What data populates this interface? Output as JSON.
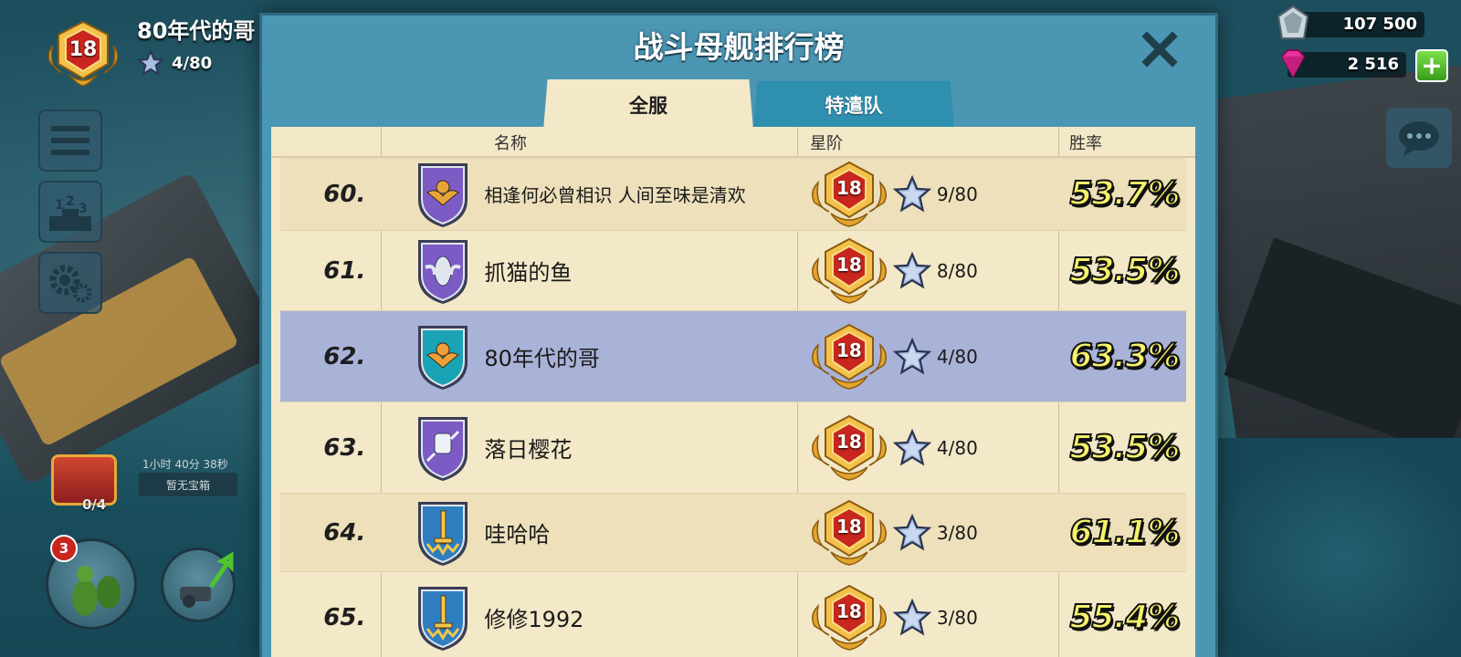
{
  "player": {
    "level": "18",
    "name": "80年代的哥",
    "stars": "4/80"
  },
  "resources": {
    "partial_left": "3",
    "steel_value": "107 500",
    "gems_value": "2 516",
    "steel_icon": "steel-icon",
    "gem_icon": "gem-icon",
    "plus_icon": "plus-icon"
  },
  "chest": {
    "timer": "1小时 40分 38秒",
    "status": "暂无宝箱",
    "count": "0/4"
  },
  "badges": {
    "army_count": "3"
  },
  "modal": {
    "title": "战斗母舰排行榜",
    "tabs": [
      {
        "label": "全服",
        "active": true
      },
      {
        "label": "特遣队",
        "active": false
      }
    ],
    "columns": {
      "name": "名称",
      "star_rank": "星阶",
      "win_rate": "胜率"
    },
    "rows": [
      {
        "rank": "60.",
        "name": "相逢何必曾相识 人间至味是清欢",
        "level": "18",
        "stars": "9/80",
        "win_rate": "53.7%",
        "shield": "purple-eagle"
      },
      {
        "rank": "61.",
        "name": "抓猫的鱼",
        "level": "18",
        "stars": "8/80",
        "win_rate": "53.5%",
        "shield": "purple-fish"
      },
      {
        "rank": "62.",
        "name": "80年代的哥",
        "level": "18",
        "stars": "4/80",
        "win_rate": "63.3%",
        "shield": "teal-eagle",
        "self": true
      },
      {
        "rank": "63.",
        "name": "落日樱花",
        "level": "18",
        "stars": "4/80",
        "win_rate": "53.5%",
        "shield": "purple-fist"
      },
      {
        "rank": "64.",
        "name": "哇哈哈",
        "level": "18",
        "stars": "3/80",
        "win_rate": "61.1%",
        "shield": "blue-sword"
      },
      {
        "rank": "65.",
        "name": "修修1992",
        "level": "18",
        "stars": "3/80",
        "win_rate": "55.4%",
        "shield": "blue-sword"
      }
    ]
  },
  "colors": {
    "modal_bg": "#4b96b3",
    "parchment": "#f3e8c8",
    "self_row": "#a9b3d8",
    "win_rate": "#f6f26a",
    "badge_gold": "#e2a52c",
    "badge_red": "#c8261e"
  }
}
